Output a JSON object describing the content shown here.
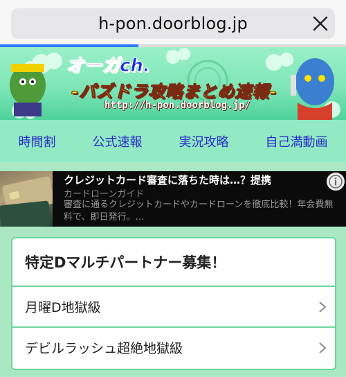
{
  "browser": {
    "url": "h-pon.doorblog.jp",
    "close_icon": "close-icon",
    "load_progress_percent": 40
  },
  "banner": {
    "brand": "オーガch.",
    "title": "-パズドラ攻略まとめ速報-",
    "url": "http://h-pon.doorblog.jp/"
  },
  "nav": {
    "items": [
      {
        "label": "時間割"
      },
      {
        "label": "公式速報"
      },
      {
        "label": "実況攻略"
      },
      {
        "label": "自己満動画"
      }
    ]
  },
  "ad": {
    "title": "クレジットカード審査に落ちた時は…？提携",
    "source": "カードローンガイド",
    "description": "審査に通るクレジットカードやカードローンを徹底比較！年会費無料で、即日発行。…",
    "info_icon": "info-icon"
  },
  "card": {
    "title": "特定Dマルチパートナー募集！",
    "items": [
      {
        "label": "月曜D地獄級"
      },
      {
        "label": "デビルラッシュ超絶地獄級"
      }
    ]
  },
  "colors": {
    "nav_link": "#2a2cc8",
    "accent_green": "#6bd59a",
    "progress": "#2f7af8"
  }
}
